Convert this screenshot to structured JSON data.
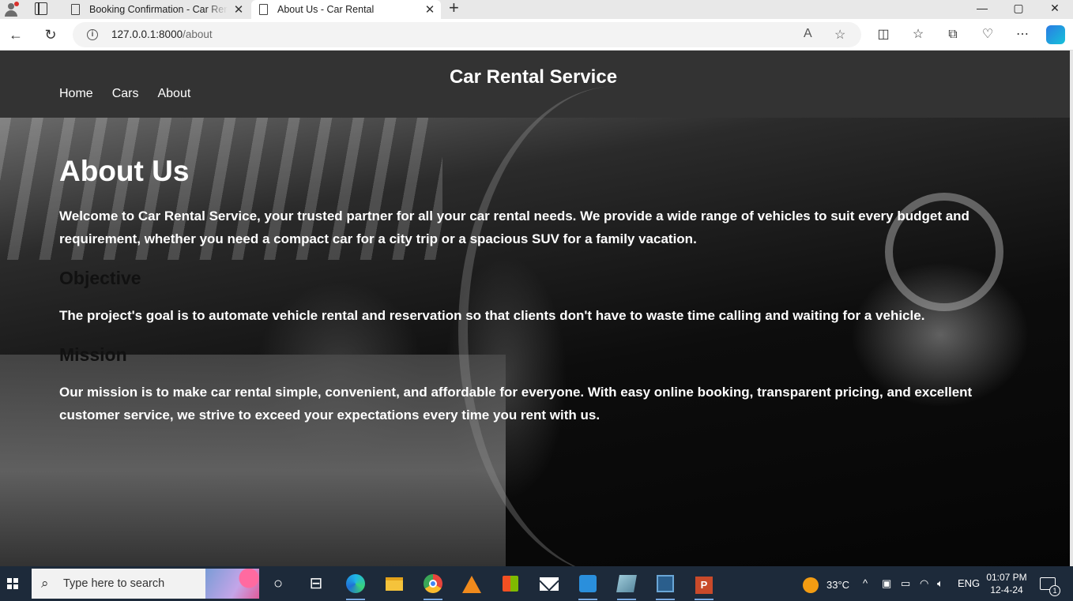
{
  "browser": {
    "tabs": [
      {
        "title": "Booking Confirmation - Car Rental"
      },
      {
        "title": "About Us - Car Rental"
      }
    ],
    "new_tab_icon": "plus-icon",
    "window_controls": {
      "minimize": "—",
      "maximize": "▢",
      "close": "✕"
    },
    "url": {
      "host": "127.0.0.1:8000",
      "path": "/about"
    },
    "icons": [
      "back-icon",
      "refresh-icon",
      "info-icon",
      "read-aloud-icon",
      "favorite-star-icon",
      "split-screen-icon",
      "favorites-icon",
      "collections-icon",
      "browser-essentials-icon",
      "more-icon",
      "copilot-icon"
    ]
  },
  "site": {
    "title": "Car Rental Service",
    "nav": [
      "Home",
      "Cars",
      "About"
    ],
    "heading": "About Us",
    "intro": "Welcome to Car Rental Service, your trusted partner for all your car rental needs. We provide a wide range of vehicles to suit every budget and requirement, whether you need a compact car for a city trip or a spacious SUV for a family vacation.",
    "objective_heading": "Objective",
    "objective_text": "The project's goal is to automate vehicle rental and reservation so that clients don't have to waste time calling and waiting for a vehicle.",
    "mission_heading": "Mission",
    "mission_text": "Our mission is to make car rental simple, convenient, and affordable for everyone. With easy online booking, transparent pricing, and excellent customer service, we strive to exceed your expectations every time you rent with us."
  },
  "taskbar": {
    "search_placeholder": "Type here to search",
    "weather": "33°C",
    "language": "ENG",
    "time": "01:07 PM",
    "date": "12-4-24",
    "notification_count": "1",
    "apps": [
      "task-view-icon",
      "edge-icon",
      "file-explorer-icon",
      "chrome-icon",
      "vlc-icon",
      "store-icon",
      "mail-icon",
      "vscode-icon",
      "app-icon",
      "workbench-icon",
      "powerpoint-icon"
    ]
  }
}
